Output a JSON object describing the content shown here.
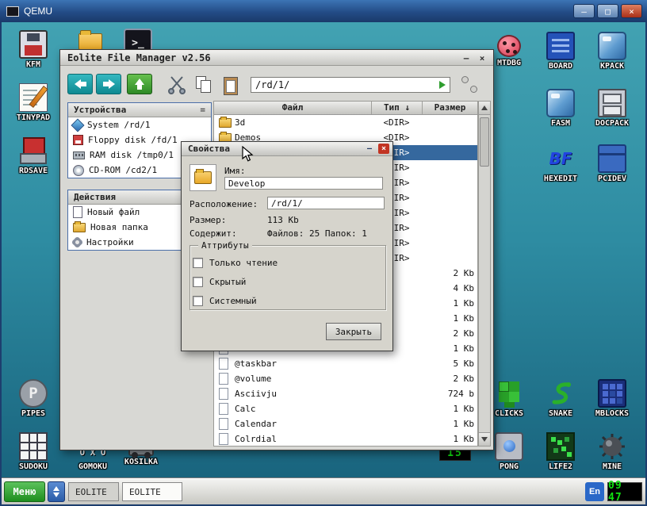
{
  "qemu": {
    "title": "QEMU",
    "controls": {
      "minimize": "–",
      "maximize": "□",
      "close": "×"
    }
  },
  "desktop": {
    "icons": [
      {
        "id": "kfm",
        "label": "KFM",
        "icon": "floppy-disk-icon"
      },
      {
        "id": "tinypad",
        "label": "TINYPAD",
        "icon": "notepad-pencil-icon"
      },
      {
        "id": "rdsave",
        "label": "RDSAVE",
        "icon": "save-disk-icon"
      },
      {
        "id": "folder",
        "label": "",
        "icon": "folder-icon"
      },
      {
        "id": "terminal",
        "label": "",
        "icon": "terminal-icon",
        "icon_text": ">_"
      },
      {
        "id": "mtdbg",
        "label": "MTDBG",
        "icon": "ladybug-icon"
      },
      {
        "id": "board",
        "label": "BOARD",
        "icon": "board-window-icon"
      },
      {
        "id": "kpack",
        "label": "KPACK",
        "icon": "ice-cube-icon"
      },
      {
        "id": "fasm",
        "label": "FASM",
        "icon": "ice-cube-icon"
      },
      {
        "id": "docpack",
        "label": "DOCPACK",
        "icon": "drawer-cabinet-icon"
      },
      {
        "id": "hexedit",
        "label": "HEXEDIT",
        "icon": "bf-letters-icon",
        "icon_text": "BF"
      },
      {
        "id": "pcidev",
        "label": "PCIDEV",
        "icon": "blue-chest-icon"
      },
      {
        "id": "clicks",
        "label": "CLICKS",
        "icon": "green-blocks-icon"
      },
      {
        "id": "snake",
        "label": "SNAKE",
        "icon": "snake-icon"
      },
      {
        "id": "mblocks",
        "label": "MBLOCKS",
        "icon": "blue-grid-icon"
      },
      {
        "id": "pipes",
        "label": "PIPES",
        "icon": "pipe-icon",
        "icon_text": "P"
      },
      {
        "id": "sudoku",
        "label": "SUDOKU",
        "icon": "sudoku-grid-icon"
      },
      {
        "id": "gomoku",
        "label": "GOMOKU",
        "icon": "xo-grid-icon",
        "icon_text": "X O X\nO X O"
      },
      {
        "id": "kosilka",
        "label": "KOSILKA",
        "icon": "mower-icon"
      },
      {
        "id": "pong",
        "label": "PONG",
        "icon": "ball-box-icon"
      },
      {
        "id": "life2",
        "label": "LIFE2",
        "icon": "life-cells-icon"
      },
      {
        "id": "mine",
        "label": "MINE",
        "icon": "sea-mine-icon"
      },
      {
        "id": "game15",
        "label": "15",
        "icon": "led-15-icon"
      }
    ]
  },
  "eolite": {
    "title": "Eolite File Manager v2.56",
    "controls": {
      "minimize": "–",
      "close": "×"
    },
    "toolbar": {
      "path": "/rd/1/"
    },
    "devices": {
      "header": "Устройства",
      "collapse_glyph": "=",
      "items": [
        {
          "label": "System /rd/1",
          "icon": "system-diamond-icon"
        },
        {
          "label": "Floppy disk /fd/1",
          "icon": "floppy-icon"
        },
        {
          "label": "RAM disk /tmp0/1",
          "icon": "ram-chip-icon"
        },
        {
          "label": "CD-ROM /cd2/1",
          "icon": "cd-disc-icon"
        }
      ]
    },
    "actions": {
      "header": "Действия",
      "items": [
        {
          "label": "Новый файл",
          "icon": "new-file-icon"
        },
        {
          "label": "Новая папка",
          "icon": "new-folder-icon"
        },
        {
          "label": "Настройки",
          "icon": "settings-gear-icon"
        }
      ]
    },
    "list": {
      "columns": {
        "file": "Файл",
        "type": "Тип",
        "type_sort": "↓",
        "size": "Размер"
      },
      "rows": [
        {
          "name": "3d",
          "type": "<DIR>",
          "size": "",
          "icon": "folder",
          "selected": false
        },
        {
          "name": "Demos",
          "type": "<DIR>",
          "size": "",
          "icon": "folder",
          "selected": false
        },
        {
          "name": "",
          "type": "<DIR>",
          "size": "",
          "icon": "folder",
          "selected": true
        },
        {
          "name": "",
          "type": "<DIR>",
          "size": "",
          "icon": "folder",
          "selected": false
        },
        {
          "name": "",
          "type": "<DIR>",
          "size": "",
          "icon": "folder",
          "selected": false
        },
        {
          "name": "",
          "type": "<DIR>",
          "size": "",
          "icon": "folder",
          "selected": false
        },
        {
          "name": "",
          "type": "<DIR>",
          "size": "",
          "icon": "folder",
          "selected": false
        },
        {
          "name": "",
          "type": "<DIR>",
          "size": "",
          "icon": "folder",
          "selected": false
        },
        {
          "name": "",
          "type": "<DIR>",
          "size": "",
          "icon": "folder",
          "selected": false
        },
        {
          "name": "",
          "type": "<DIR>",
          "size": "",
          "icon": "folder",
          "selected": false
        },
        {
          "name": "",
          "type": "",
          "size": "2 Kb",
          "icon": "file",
          "selected": false
        },
        {
          "name": "",
          "type": "",
          "size": "4 Kb",
          "icon": "file",
          "selected": false
        },
        {
          "name": "",
          "type": "",
          "size": "1 Kb",
          "icon": "file",
          "selected": false
        },
        {
          "name": "",
          "type": "",
          "size": "1 Kb",
          "icon": "file",
          "selected": false
        },
        {
          "name": "",
          "type": "",
          "size": "2 Kb",
          "icon": "file",
          "selected": false
        },
        {
          "name": "",
          "type": "",
          "size": "1 Kb",
          "icon": "file",
          "selected": false
        },
        {
          "name": "@taskbar",
          "type": "",
          "size": "5 Kb",
          "icon": "file",
          "selected": false
        },
        {
          "name": "@volume",
          "type": "",
          "size": "2 Kb",
          "icon": "file",
          "selected": false
        },
        {
          "name": "Asciivju",
          "type": "",
          "size": "724 b",
          "icon": "file",
          "selected": false
        },
        {
          "name": "Calc",
          "type": "",
          "size": "1 Kb",
          "icon": "file",
          "selected": false
        },
        {
          "name": "Calendar",
          "type": "",
          "size": "1 Kb",
          "icon": "file",
          "selected": false
        },
        {
          "name": "Colrdial",
          "type": "",
          "size": "1 Kb",
          "icon": "file",
          "selected": false
        }
      ]
    }
  },
  "properties_dialog": {
    "title": "Свойства",
    "controls": {
      "minimize": "–",
      "close": "×"
    },
    "fields": {
      "name_label": "Имя:",
      "name_value": "Develop",
      "location_label": "Расположение:",
      "location_value": "/rd/1/",
      "size_label": "Размер:",
      "size_value": "113 Kb",
      "contains_label": "Содержит:",
      "contains_value": "Файлов: 25 Папок: 1"
    },
    "attributes": {
      "header": "Аттрибуты",
      "checkboxes": [
        {
          "label": "Только чтение",
          "checked": false
        },
        {
          "label": "Скрытый",
          "checked": false
        },
        {
          "label": "Системный",
          "checked": false
        }
      ]
    },
    "close_button": "Закрыть"
  },
  "taskbar": {
    "menu": "Меню",
    "tasks": [
      "EOLITE",
      "EOLITE"
    ],
    "language": "En",
    "clock": "09 47"
  }
}
